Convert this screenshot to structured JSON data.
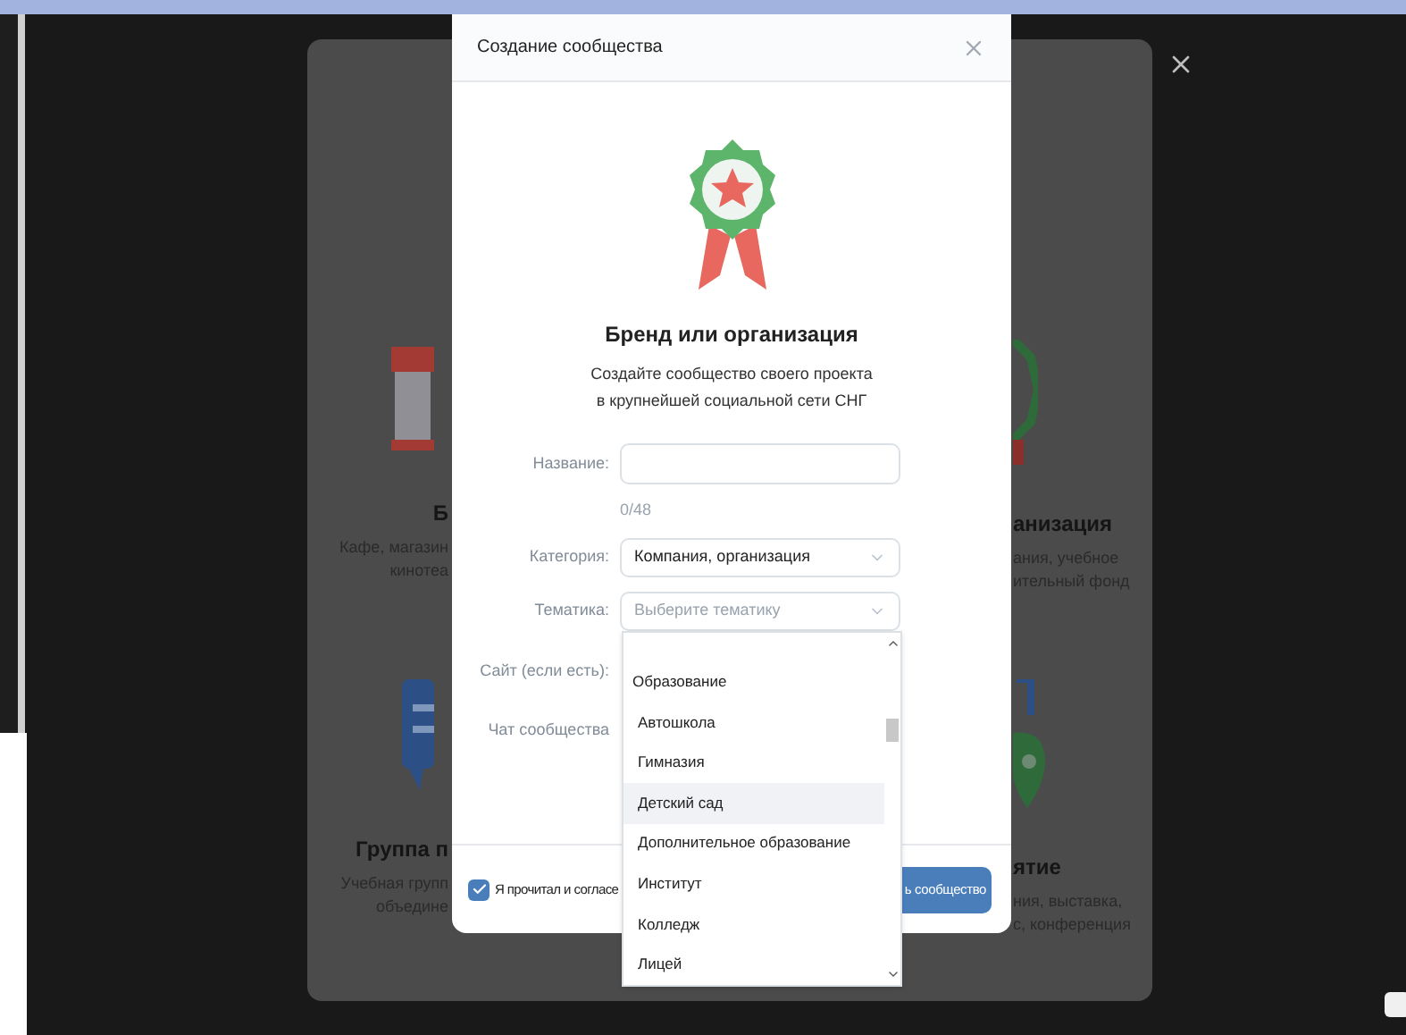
{
  "background_cards": [
    {
      "title": "Б",
      "lines": [
        "Кафе, магазин",
        "кинотеа"
      ]
    },
    {
      "title": "анизация",
      "lines": [
        "ания, учебное",
        "ительный фонд"
      ]
    },
    {
      "title": "Группа п",
      "lines": [
        "Учебная групп",
        "объедине"
      ]
    },
    {
      "title": "ятие",
      "lines": [
        "ния, выставка,",
        "с, конференция"
      ]
    }
  ],
  "dialog": {
    "title": "Создание сообщества",
    "heading": "Бренд или организация",
    "subtitle": [
      "Создайте сообщество своего проекта",
      "в крупнейшей социальной сети СНГ"
    ],
    "fields": [
      {
        "kind": "text",
        "label": "Название:",
        "counter": "0/48"
      },
      {
        "kind": "select",
        "label": "Категория:",
        "value": "Компания, организация"
      },
      {
        "kind": "select",
        "label": "Тематика:",
        "placeholder": "Выберите тематику"
      },
      {
        "kind": "label",
        "label": "Сайт (если есть):"
      },
      {
        "kind": "label",
        "label": "Чат сообщества"
      }
    ],
    "dropdown": [
      {
        "kind": "group",
        "label": "Образование",
        "selected": false
      },
      {
        "kind": "option",
        "label": "Автошкола",
        "selected": false
      },
      {
        "kind": "option",
        "label": "Гимназия",
        "selected": false
      },
      {
        "kind": "option",
        "label": "Детский сад",
        "selected": true
      },
      {
        "kind": "option",
        "label": "Дополнительное образование",
        "selected": false
      },
      {
        "kind": "option",
        "label": "Институт",
        "selected": false
      },
      {
        "kind": "option",
        "label": "Колледж",
        "selected": false
      },
      {
        "kind": "option",
        "label": "Лицей",
        "selected": false
      }
    ],
    "agreement": {
      "checked": true,
      "label": "Я прочитал и согласе"
    },
    "submit": "ь сообщество"
  }
}
